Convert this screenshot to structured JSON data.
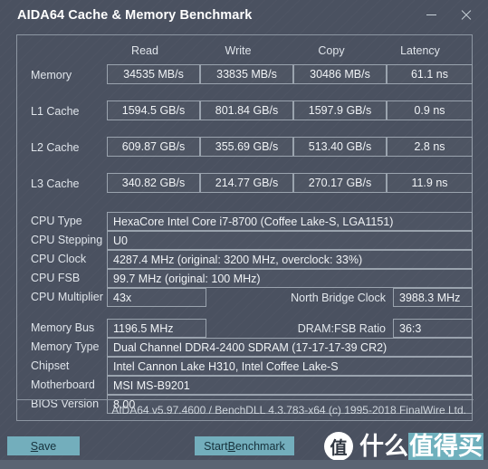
{
  "window": {
    "title": "AIDA64 Cache & Memory Benchmark",
    "minimize_label": "–",
    "close_label": "×"
  },
  "benchmark": {
    "columns": [
      "Read",
      "Write",
      "Copy",
      "Latency"
    ],
    "rows": [
      {
        "label": "Memory",
        "values": [
          "34535 MB/s",
          "33835 MB/s",
          "30486 MB/s",
          "61.1 ns"
        ]
      },
      {
        "label": "L1 Cache",
        "values": [
          "1594.5 GB/s",
          "801.84 GB/s",
          "1597.9 GB/s",
          "0.9 ns"
        ]
      },
      {
        "label": "L2 Cache",
        "values": [
          "609.87 GB/s",
          "355.69 GB/s",
          "513.40 GB/s",
          "2.8 ns"
        ]
      },
      {
        "label": "L3 Cache",
        "values": [
          "340.82 GB/s",
          "214.77 GB/s",
          "270.17 GB/s",
          "11.9 ns"
        ]
      }
    ]
  },
  "cpu_info": {
    "type_label": "CPU Type",
    "type_value": "HexaCore Intel Core i7-8700  (Coffee Lake-S, LGA1151)",
    "stepping_label": "CPU Stepping",
    "stepping_value": "U0",
    "clock_label": "CPU Clock",
    "clock_value": "4287.4 MHz  (original: 3200 MHz, overclock: 33%)",
    "fsb_label": "CPU FSB",
    "fsb_value": "99.7 MHz  (original: 100 MHz)",
    "multiplier_label": "CPU Multiplier",
    "multiplier_value": "43x",
    "north_bridge_label": "North Bridge Clock",
    "north_bridge_value": "3988.3 MHz"
  },
  "memory_info": {
    "bus_label": "Memory Bus",
    "bus_value": "1196.5 MHz",
    "dram_fsb_label": "DRAM:FSB Ratio",
    "dram_fsb_value": "36:3",
    "type_label": "Memory Type",
    "type_value": "Dual Channel DDR4-2400 SDRAM  (17-17-17-39 CR2)",
    "chipset_label": "Chipset",
    "chipset_value": "Intel Cannon Lake H310, Intel Coffee Lake-S",
    "motherboard_label": "Motherboard",
    "motherboard_value": "MSI MS-B9201",
    "bios_label": "BIOS Version",
    "bios_value": "8.00"
  },
  "footer": {
    "version_text": "AIDA64 v5.97.4600 / BenchDLL 4.3.783-x64  (c) 1995-2018 FinalWire Ltd."
  },
  "actions": {
    "save_prefix": "",
    "save_accel": "S",
    "save_suffix": "ave",
    "start_prefix": "Start ",
    "start_accel": "B",
    "start_suffix": "enchmark"
  },
  "watermark": {
    "badge": "值",
    "text_plain": "什么",
    "text_highlight": "值得买"
  },
  "colors": {
    "window_bg": "#4a5160",
    "accent": "#73aebc",
    "border": "#8d96a2",
    "text": "#f0f3f6",
    "statusbar": "#5a6473"
  }
}
